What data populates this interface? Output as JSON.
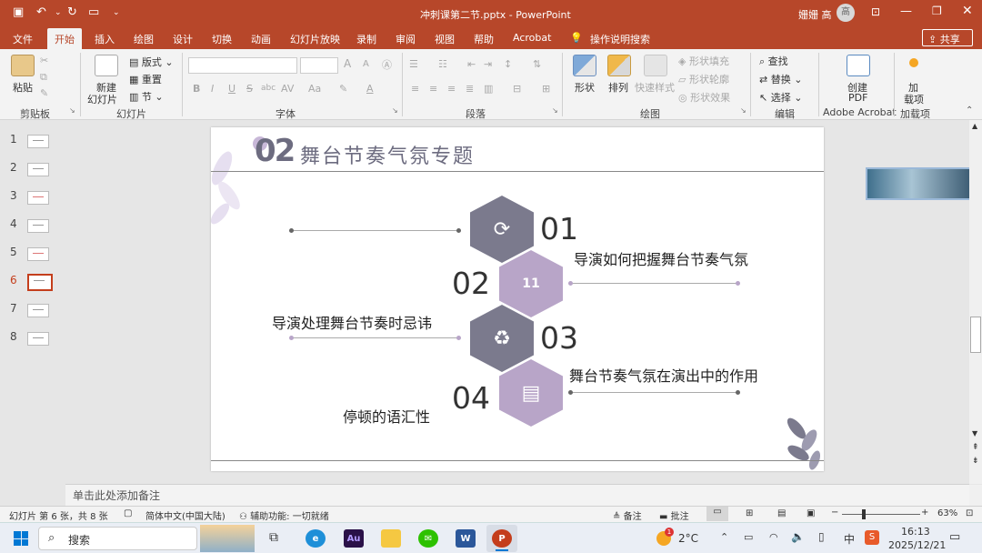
{
  "title_bar": {
    "file_title": "冲刺课第二节.pptx - PowerPoint",
    "user": "姗姗 高",
    "user_initial": "高"
  },
  "tabs": [
    "文件",
    "开始",
    "插入",
    "绘图",
    "设计",
    "切换",
    "动画",
    "幻灯片放映",
    "录制",
    "审阅",
    "视图",
    "帮助",
    "Acrobat"
  ],
  "tell_me": "操作说明搜索",
  "share": "共享",
  "ribbon": {
    "clipboard": {
      "paste": "粘贴",
      "group": "剪贴板"
    },
    "slides": {
      "new_slide": "新建",
      "new_slide2": "幻灯片",
      "layout": "版式",
      "reset": "重置",
      "section": "节",
      "group": "幻灯片"
    },
    "font": {
      "group": "字体",
      "bold": "B",
      "italic": "I",
      "underline": "U",
      "strike": "S",
      "shadow": "abc",
      "spacing": "AV",
      "case": "Aa",
      "color": "A"
    },
    "paragraph": {
      "group": "段落"
    },
    "drawing": {
      "shape": "形状",
      "arrange": "排列",
      "quick_style": "快速样式",
      "fill": "形状填充",
      "outline": "形状轮廓",
      "effect": "形状效果",
      "group": "绘图"
    },
    "editing": {
      "find": "查找",
      "replace": "替换",
      "select": "选择",
      "group": "编辑"
    },
    "acrobat": {
      "create_pdf": "创建",
      "create_pdf2": "PDF",
      "group": "Adobe Acrobat"
    },
    "addins": {
      "add": "加",
      "add2": "载项",
      "group": "加载项"
    }
  },
  "thumbs": [
    "1",
    "2",
    "3",
    "4",
    "5",
    "6",
    "7",
    "8"
  ],
  "active_slide": 6,
  "slide": {
    "number_prefix": "02",
    "heading": "舞台节奏气氛专题",
    "items": [
      {
        "num": "01",
        "text": "导演如何把握舞台节奏气氛",
        "icon": "⟳"
      },
      {
        "num": "02",
        "text": "导演处理舞台节奏时忌讳",
        "icon": "11"
      },
      {
        "num": "03",
        "text": "舞台节奏气氛在演出中的作用",
        "icon": "♻"
      },
      {
        "num": "04",
        "text": "停顿的语汇性",
        "icon": "▤"
      }
    ],
    "colors": {
      "gray": "#7b7a8d",
      "purple": "#b8a5c8"
    }
  },
  "notes_placeholder": "单击此处添加备注",
  "status": {
    "slide_info": "幻灯片 第 6 张，共 8 张",
    "language": "简体中文(中国大陆)",
    "accessibility": "辅助功能: 一切就绪",
    "notes": "备注",
    "comments": "批注",
    "zoom": "63%"
  },
  "taskbar": {
    "search": "搜索",
    "weather": "2°C",
    "ime": "中",
    "time": "16:13",
    "date": "2025/12/21",
    "weather_badge": "1"
  }
}
